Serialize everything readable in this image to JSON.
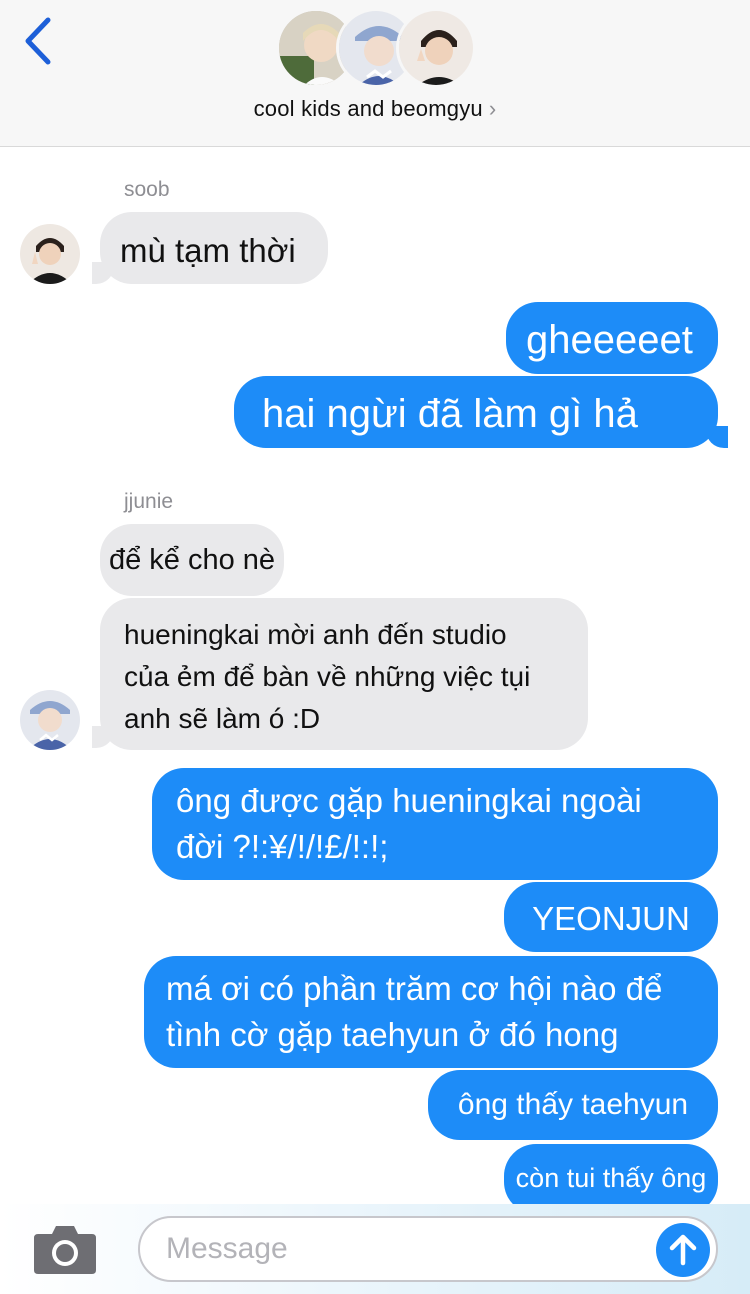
{
  "header": {
    "back_icon": "chevron-left-icon",
    "group_name": "cool kids and beomgyu",
    "chevron": "›",
    "accent": "#1d8cf8"
  },
  "messages": [
    {
      "sender": "soob",
      "direction": "incoming",
      "text": "mù tạm thời"
    },
    {
      "direction": "outgoing",
      "text": "gheeeeet"
    },
    {
      "direction": "outgoing",
      "text": "hai ngừi đã làm gì hả"
    },
    {
      "sender": "jjunie",
      "direction": "incoming",
      "text": "để kể cho nè"
    },
    {
      "direction": "incoming",
      "lines": [
        "hueningkai mời anh đến studio",
        "của ẻm để bàn về những việc tụi",
        "anh sẽ làm ó :D"
      ]
    },
    {
      "direction": "outgoing",
      "lines": [
        "ông được gặp hueningkai ngoài",
        "đời ?!:¥/!/!£/!:!;"
      ]
    },
    {
      "direction": "outgoing",
      "text": "YEONJUN"
    },
    {
      "direction": "outgoing",
      "lines": [
        "má ơi có phần trăm cơ hội nào để",
        "tình cờ gặp taehyun ở đó hong"
      ]
    },
    {
      "direction": "outgoing",
      "text": "ông thấy taehyun"
    },
    {
      "direction": "outgoing",
      "text": "còn tui thấy ông"
    }
  ],
  "composer": {
    "placeholder": "Message",
    "camera_icon": "camera-icon",
    "send_icon": "arrow-up-icon"
  },
  "colors": {
    "incoming_bubble": "#e9e9eb",
    "outgoing_bubble": "#1d8cf8",
    "sender_label": "#8e8e93"
  }
}
